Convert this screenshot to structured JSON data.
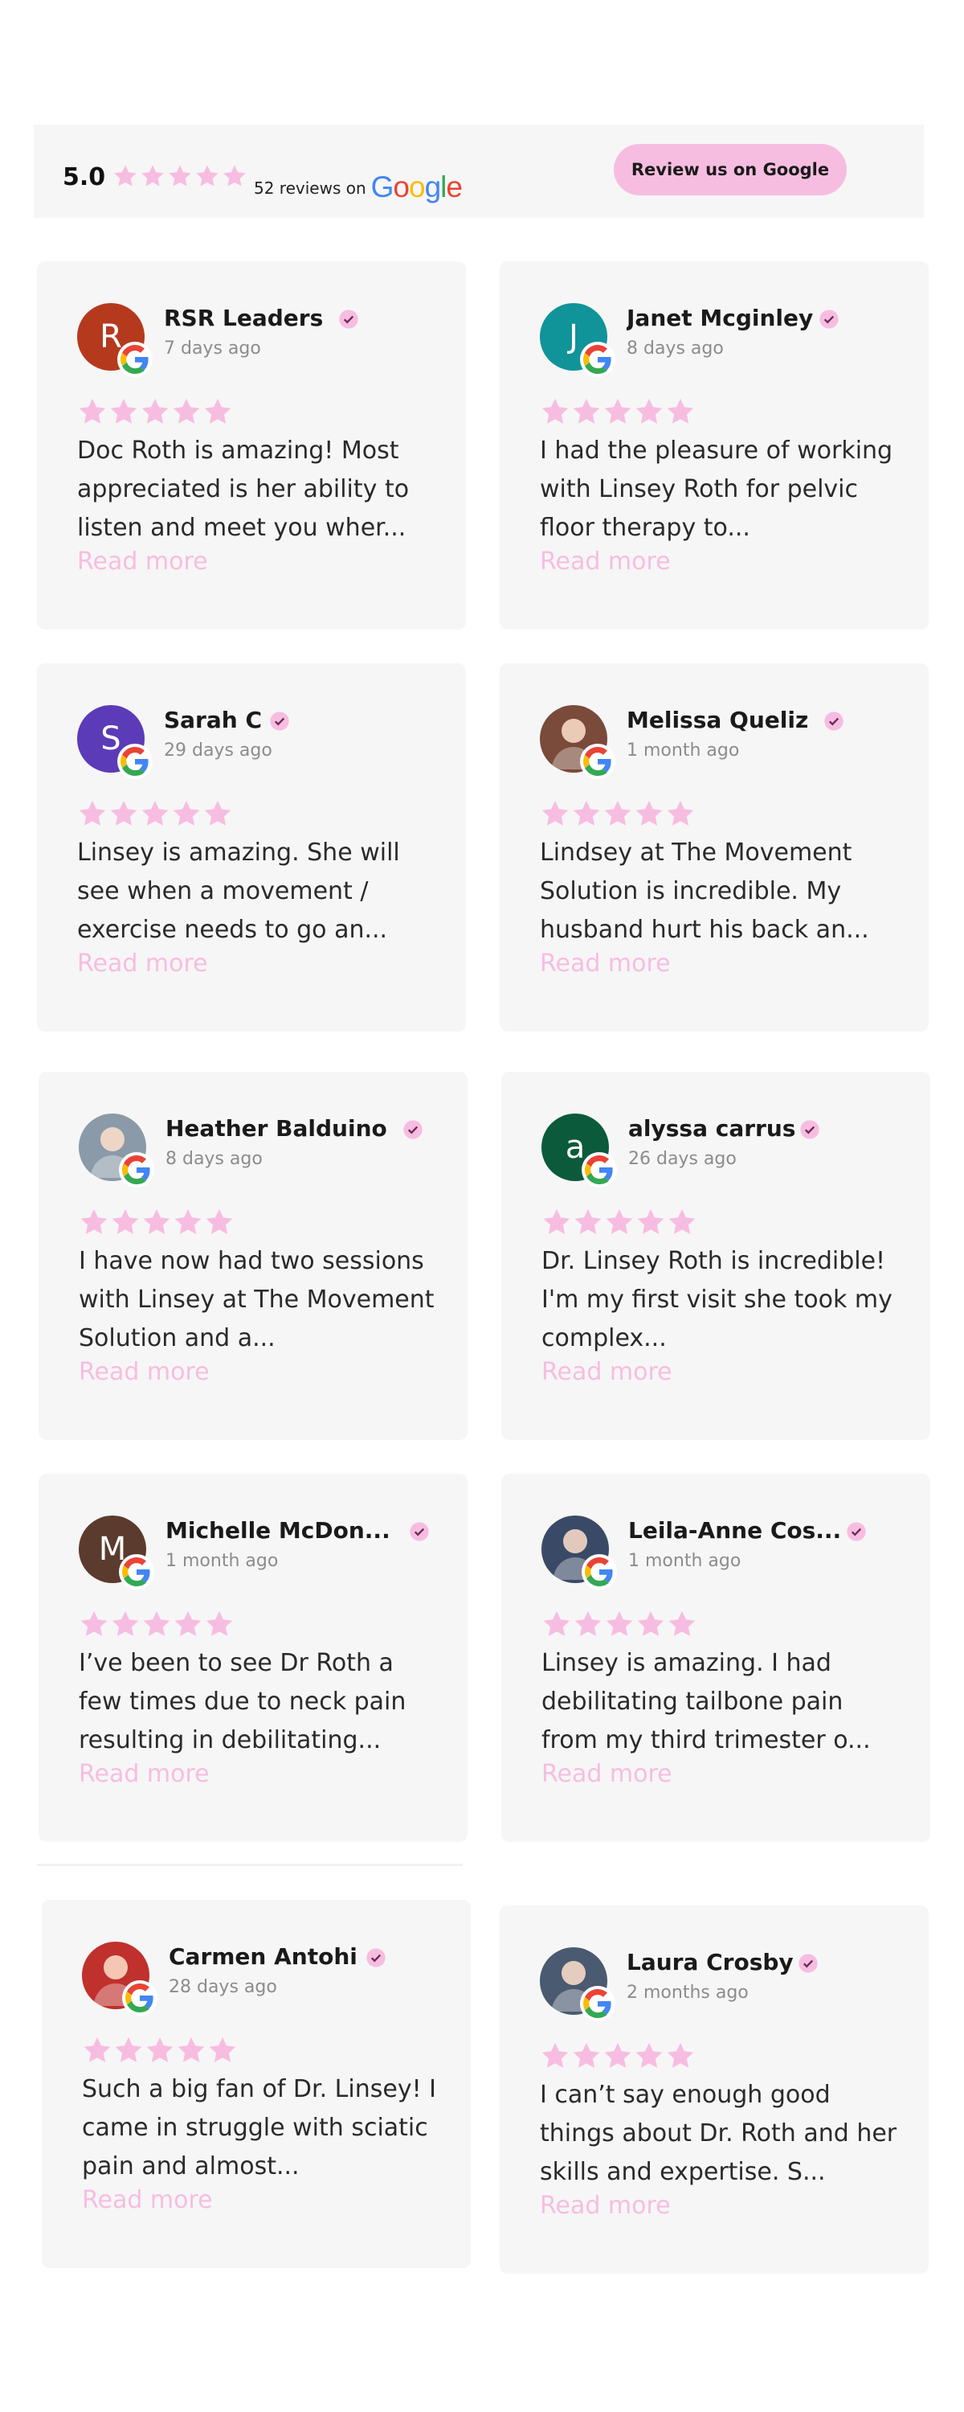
{
  "header": {
    "rating": "5.0",
    "reviews_text": "52 reviews on",
    "google_logo": "Google",
    "cta": "Review us on Google"
  },
  "colors": {
    "star": "#f7bde1",
    "accent": "#f7bde1",
    "card_bg": "#f6f6f6"
  },
  "reviews": [
    {
      "name": "RSR Leaders",
      "date": "7 days ago",
      "rating": 5,
      "text": "Doc Roth is amazing! Most appreciated is her ability to listen and meet you wher...",
      "more": "Read more",
      "avatar": {
        "type": "initial",
        "letter": "R",
        "color": "#b5391d"
      }
    },
    {
      "name": "Janet Mcginley",
      "date": "8 days ago",
      "rating": 5,
      "text": "I had the pleasure of working with Linsey Roth for pelvic floor therapy to...",
      "more": "Read more",
      "avatar": {
        "type": "initial",
        "letter": "J",
        "color": "#11939a"
      }
    },
    {
      "name": "Sarah C",
      "date": "29 days ago",
      "rating": 5,
      "text": "Linsey is amazing. She will see when a movement / exercise needs to go an...",
      "more": "Read more",
      "avatar": {
        "type": "initial",
        "letter": "S",
        "color": "#5b3bb7"
      }
    },
    {
      "name": "Melissa Queliz",
      "date": "1 month ago",
      "rating": 5,
      "text": "Lindsey at The Movement Solution is incredible. My husband hurt his back an...",
      "more": "Read more",
      "avatar": {
        "type": "photo",
        "icon": "user-photo-icon",
        "color": "#7a4a3a"
      }
    },
    {
      "name": "Heather Balduino",
      "date": "8 days ago",
      "rating": 5,
      "text": "I have now had two sessions with Linsey at The Movement Solution and a...",
      "more": "Read more",
      "avatar": {
        "type": "photo",
        "icon": "user-photo-icon",
        "color": "#8a9aa8"
      }
    },
    {
      "name": "alyssa carrus",
      "date": "26 days ago",
      "rating": 5,
      "text": "Dr. Linsey Roth is incredible! I'm my first visit she took my complex...",
      "more": "Read more",
      "avatar": {
        "type": "initial",
        "letter": "a",
        "color": "#0b5a3c"
      }
    },
    {
      "name": "Michelle McDon...",
      "date": "1 month ago",
      "rating": 5,
      "text": "I’ve been to see Dr Roth a few times due to neck pain resulting in debilitating...",
      "more": "Read more",
      "avatar": {
        "type": "initial",
        "letter": "M",
        "color": "#5b3b2e"
      }
    },
    {
      "name": "Leila-Anne Cos...",
      "date": "1 month ago",
      "rating": 5,
      "text": "Linsey is amazing. I had debilitating tailbone pain from my third trimester o...",
      "more": "Read more",
      "avatar": {
        "type": "photo",
        "icon": "user-photo-icon",
        "color": "#3a4a66"
      }
    },
    {
      "name": "Carmen Antohi",
      "date": "28 days ago",
      "rating": 5,
      "text": "Such a big fan of Dr. Linsey! I came in struggle with sciatic pain and almost...",
      "more": "Read more",
      "avatar": {
        "type": "photo",
        "icon": "flower-photo-icon",
        "color": "#c0302c"
      }
    },
    {
      "name": "Laura Crosby",
      "date": "2 months ago",
      "rating": 5,
      "text": "I can’t say enough good things about Dr. Roth and her skills and expertise. S...",
      "more": "Read more",
      "avatar": {
        "type": "photo",
        "icon": "user-photo-icon",
        "color": "#4a5a70"
      }
    }
  ]
}
